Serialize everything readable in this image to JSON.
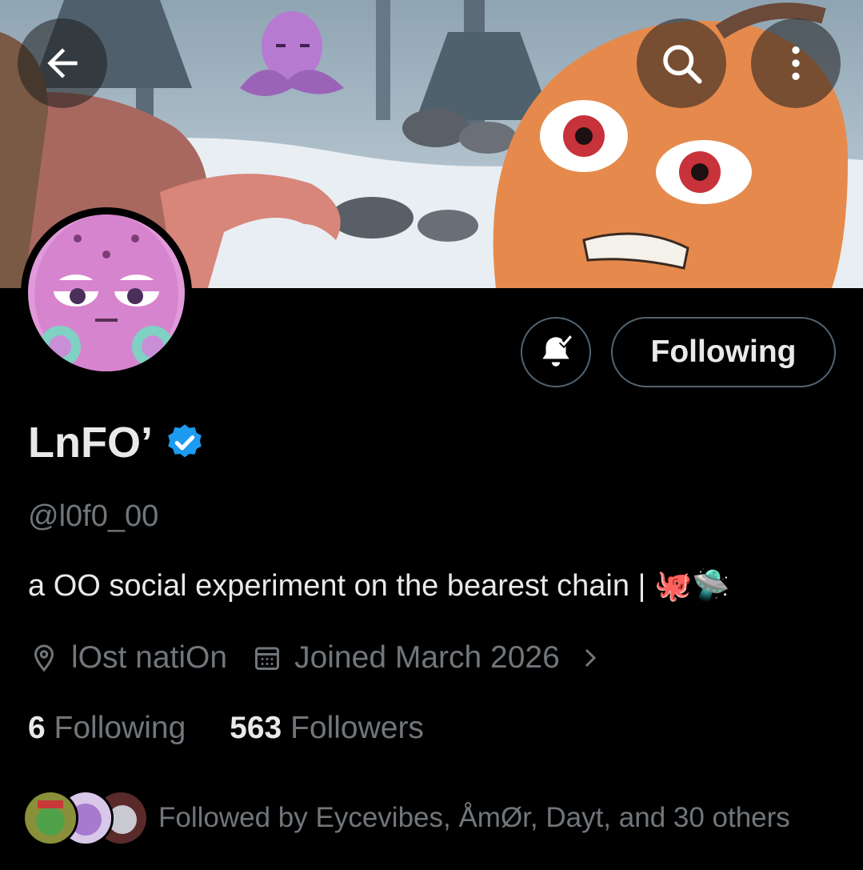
{
  "header": {
    "back_icon": "arrow-left-icon",
    "search_icon": "search-icon",
    "more_icon": "more-vertical-icon"
  },
  "actions": {
    "notify_icon": "bell-check-icon",
    "following_label": "Following"
  },
  "profile": {
    "display_name": "LnFO’",
    "verified": true,
    "handle": "@l0f0_00",
    "bio": "a OO social experiment on the bearest chain | 🐙🛸",
    "location": "lOst natiOn",
    "joined": "Joined March 2026"
  },
  "stats": {
    "following_count": "6",
    "following_label": "Following",
    "followers_count": "563",
    "followers_label": "Followers"
  },
  "followed_by": {
    "text": "Followed by Eycevibes, ÅmØr, Dayt, and 30 others"
  },
  "colors": {
    "background": "#000000",
    "primary_text": "#e7e9ea",
    "secondary_text": "#71767b",
    "verified_blue": "#1d9bf0",
    "border": "#536471"
  }
}
